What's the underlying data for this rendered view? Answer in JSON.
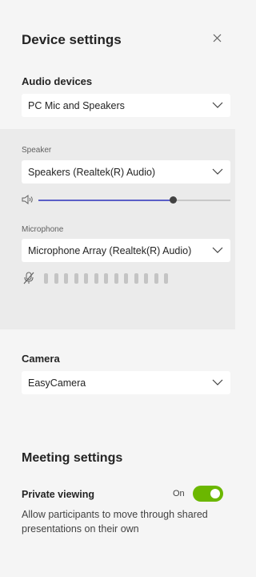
{
  "panel": {
    "title": "Device settings",
    "close_icon": "close-icon"
  },
  "audio": {
    "section_label": "Audio devices",
    "selected_device": "PC Mic and Speakers",
    "speaker": {
      "label": "Speaker",
      "selected": "Speakers (Realtek(R) Audio)",
      "volume_percent": 70
    },
    "microphone": {
      "label": "Microphone",
      "selected": "Microphone Array (Realtek(R) Audio)",
      "level_bar_count": 13,
      "muted_icon": "mic-off-icon"
    }
  },
  "camera": {
    "section_label": "Camera",
    "selected": "EasyCamera"
  },
  "meeting": {
    "section_label": "Meeting settings",
    "private_viewing": {
      "label": "Private viewing",
      "state_label": "On",
      "enabled": true,
      "description": "Allow participants to move through shared presentations on their own"
    }
  },
  "colors": {
    "accent": "#5b5fc7",
    "toggle_on": "#6bb700",
    "panel_bg": "#f5f5f5",
    "grey_block": "#ebebeb"
  }
}
